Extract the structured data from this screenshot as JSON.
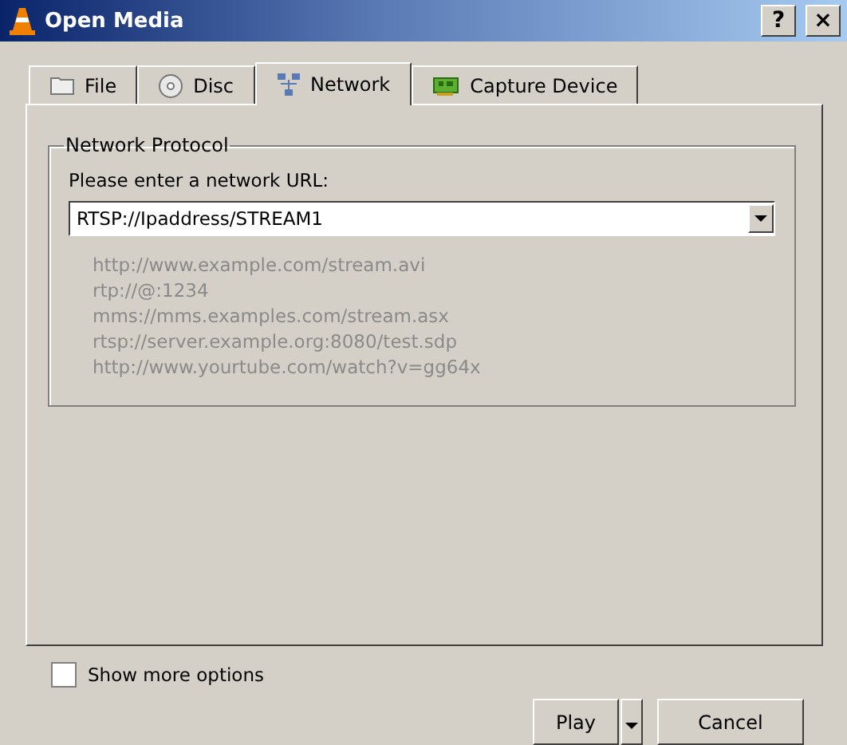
{
  "window": {
    "title": "Open Media",
    "buttons": [
      "?",
      "×"
    ]
  },
  "tabs": [
    {
      "label": "File",
      "selected": false
    },
    {
      "label": "Disc",
      "selected": false
    },
    {
      "label": "Network",
      "selected": true
    },
    {
      "label": "Capture Device",
      "selected": false
    }
  ],
  "group": {
    "title": "Network Protocol",
    "prompt": "Please enter a network URL:",
    "url": "RTSP://Ipaddress/STREAM1",
    "examples": [
      "http://www.example.com/stream.avi",
      "rtp://@:1234",
      "mms://mms.examples.com/stream.asx",
      "rtsp://server.example.org:8080/test.sdp",
      "http://www.yourtube.com/watch?v=gg64x"
    ]
  },
  "show_more": {
    "label": "Show more options",
    "checked": false
  },
  "buttons": {
    "play": "Play",
    "cancel": "Cancel"
  }
}
